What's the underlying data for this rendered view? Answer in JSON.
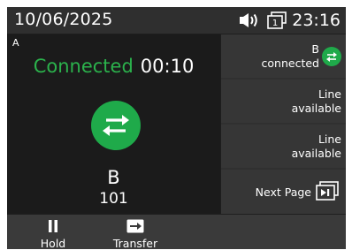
{
  "status": {
    "date": "10/06/2025",
    "time": "23:16",
    "icons": [
      "speaker-icon",
      "line-key-icon"
    ],
    "line_key_number": "1"
  },
  "call": {
    "line_letter": "A",
    "state": "Connected",
    "timer": "00:10",
    "icon": "transfer-arrows-icon",
    "callee_name": "B",
    "callee_number": "101"
  },
  "line_keys": [
    {
      "title": "B",
      "subtitle": "connected",
      "icon": "transfer-arrows-icon"
    },
    {
      "title": "Line",
      "subtitle": "available"
    },
    {
      "title": "Line",
      "subtitle": "available"
    },
    {
      "title": "Next Page",
      "icon": "next-page-icon"
    }
  ],
  "softkeys": [
    {
      "label": "Hold",
      "icon": "pause-icon"
    },
    {
      "label": "Transfer",
      "icon": "transfer-icon"
    }
  ],
  "colors": {
    "accent_green": "#1faa4a",
    "connected_text": "#2bb24c",
    "background": "#1b1b1b",
    "status_bar": "#2f2f2f",
    "line_key": "#363636",
    "softkey_bar": "#3a3a3a"
  }
}
